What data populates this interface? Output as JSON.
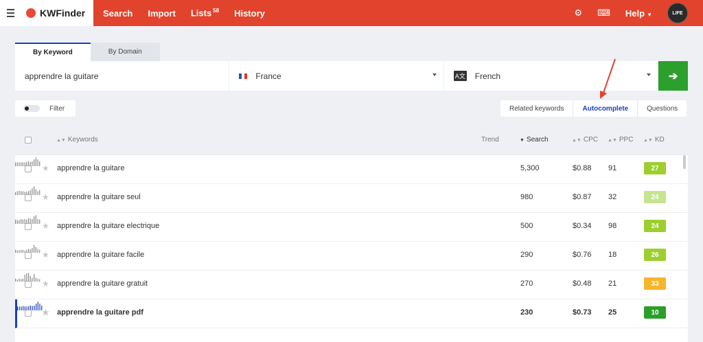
{
  "topbar": {
    "brand": "KWFinder",
    "nav": [
      {
        "label": "Search",
        "badge": ""
      },
      {
        "label": "Import",
        "badge": ""
      },
      {
        "label": "Lists",
        "badge": "58"
      },
      {
        "label": "History",
        "badge": ""
      }
    ],
    "help_label": "Help",
    "avatar_text": "LIFE",
    "bg_color": "#e1432d"
  },
  "search_tabs": [
    "By Keyword",
    "By Domain"
  ],
  "search": {
    "keyword": "apprendre la guitare",
    "country": "France",
    "language": "French",
    "lang_icon_text": "A文"
  },
  "filter_label": "Filter",
  "mode_tabs": [
    "Related keywords",
    "Autocomplete",
    "Questions"
  ],
  "table": {
    "headers": {
      "keywords": "Keywords",
      "trend": "Trend",
      "search": "Search",
      "cpc": "CPC",
      "ppc": "PPC",
      "kd": "KD"
    },
    "rows": [
      {
        "keyword": "apprendre la guitare",
        "search": "5,300",
        "cpc": "$0.88",
        "ppc": "91",
        "kd": "27",
        "kd_color": "#9ccf2e",
        "trend": [
          0.4,
          0.4,
          0.4,
          0.4,
          0.4,
          0.4,
          0.45,
          0.5,
          0.45,
          0.5,
          0.7,
          0.9,
          0.7,
          0.5
        ],
        "trend_color": "#888"
      },
      {
        "keyword": "apprendre la guitare seul",
        "search": "980",
        "cpc": "$0.87",
        "ppc": "32",
        "kd": "24",
        "kd_color": "#c5e48f",
        "trend": [
          0.3,
          0.4,
          0.45,
          0.4,
          0.4,
          0.35,
          0.35,
          0.4,
          0.5,
          0.7,
          0.9,
          0.6,
          0.4,
          0.5
        ],
        "trend_color": "#888"
      },
      {
        "keyword": "apprendre la guitare electrique",
        "search": "500",
        "cpc": "$0.34",
        "ppc": "98",
        "kd": "24",
        "kd_color": "#9ccf2e",
        "trend": [
          0.45,
          0.4,
          0.4,
          0.5,
          0.45,
          0.5,
          0.45,
          0.6,
          0.55,
          0.5,
          0.8,
          0.9,
          0.5,
          0.45
        ],
        "trend_color": "#888"
      },
      {
        "keyword": "apprendre la guitare facile",
        "search": "290",
        "cpc": "$0.76",
        "ppc": "18",
        "kd": "26",
        "kd_color": "#9ccf2e",
        "trend": [
          0.3,
          0.25,
          0.25,
          0.3,
          0.3,
          0.2,
          0.3,
          0.4,
          0.35,
          0.5,
          0.8,
          0.6,
          0.4,
          0.3
        ],
        "trend_color": "#888"
      },
      {
        "keyword": "apprendre la guitare gratuit",
        "search": "270",
        "cpc": "$0.48",
        "ppc": "21",
        "kd": "33",
        "kd_color": "#f7b52c",
        "trend": [
          0.3,
          0.2,
          0.3,
          0.25,
          0.3,
          0.7,
          0.85,
          0.9,
          0.6,
          0.4,
          0.8,
          0.4,
          0.3,
          0.25
        ],
        "trend_color": "#888"
      },
      {
        "keyword": "apprendre la guitare pdf",
        "search": "230",
        "cpc": "$0.73",
        "ppc": "25",
        "kd": "10",
        "kd_color": "#2aa02a",
        "trend": [
          0.4,
          0.4,
          0.4,
          0.45,
          0.4,
          0.4,
          0.45,
          0.5,
          0.45,
          0.5,
          0.7,
          0.9,
          0.7,
          0.5
        ],
        "trend_color": "#1d3fb7",
        "selected": true
      }
    ]
  }
}
